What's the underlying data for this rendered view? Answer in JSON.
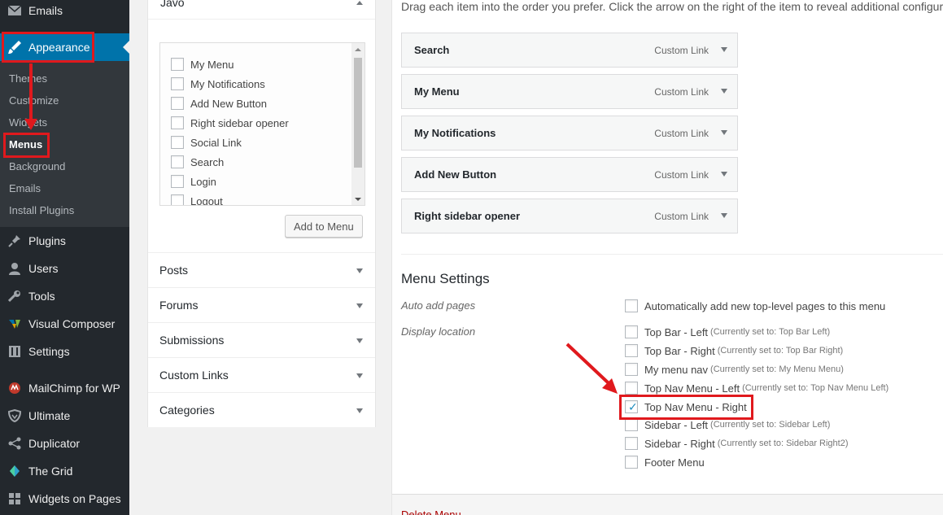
{
  "sidebar": {
    "top_items": [
      {
        "label": "Emails",
        "icon": "envelope-icon"
      },
      {
        "label": "Appearance",
        "icon": "paintbrush-icon"
      }
    ],
    "submenu": [
      "Themes",
      "Customize",
      "Widgets",
      "Menus",
      "Background",
      "Emails",
      "Install Plugins"
    ],
    "bottom_items": [
      {
        "label": "Plugins",
        "icon": "plug-icon"
      },
      {
        "label": "Users",
        "icon": "user-icon"
      },
      {
        "label": "Tools",
        "icon": "wrench-icon"
      },
      {
        "label": "Visual Composer",
        "icon": "visual-composer-icon"
      },
      {
        "label": "Settings",
        "icon": "settings-icon"
      },
      {
        "label": "MailChimp for WP",
        "icon": "mailchimp-icon"
      },
      {
        "label": "Ultimate",
        "icon": "shield-icon"
      },
      {
        "label": "Duplicator",
        "icon": "share-icon"
      },
      {
        "label": "The Grid",
        "icon": "grid-icon"
      },
      {
        "label": "Widgets on Pages",
        "icon": "widgets-icon"
      }
    ]
  },
  "left_panel": {
    "header": "Javo",
    "checklist": [
      "My Menu",
      "My Notifications",
      "Add New Button",
      "Right sidebar opener",
      "Social Link",
      "Search",
      "Login",
      "Logout"
    ],
    "add_button": "Add to Menu",
    "sections": [
      "Posts",
      "Forums",
      "Submissions",
      "Custom Links",
      "Categories"
    ]
  },
  "right_panel": {
    "instructions": "Drag each item into the order you prefer. Click the arrow on the right of the item to reveal additional configuration options.",
    "menu_items": [
      {
        "title": "Search",
        "type": "Custom Link"
      },
      {
        "title": "My Menu",
        "type": "Custom Link"
      },
      {
        "title": "My Notifications",
        "type": "Custom Link"
      },
      {
        "title": "Add New Button",
        "type": "Custom Link"
      },
      {
        "title": "Right sidebar opener",
        "type": "Custom Link"
      }
    ],
    "settings_title": "Menu Settings",
    "auto_add_label": "Auto add pages",
    "auto_add_option": "Automatically add new top-level pages to this menu",
    "display_location_label": "Display location",
    "locations": [
      {
        "label": "Top Bar - Left",
        "note": "(Currently set to: Top Bar Left)",
        "checked": false
      },
      {
        "label": "Top Bar - Right",
        "note": "(Currently set to: Top Bar Right)",
        "checked": false
      },
      {
        "label": "My menu nav",
        "note": "(Currently set to: My Menu Menu)",
        "checked": false
      },
      {
        "label": "Top Nav Menu - Left",
        "note": "(Currently set to: Top Nav Menu Left)",
        "checked": false
      },
      {
        "label": "Top Nav Menu - Right",
        "note": "",
        "checked": true
      },
      {
        "label": "Sidebar - Left",
        "note": "(Currently set to: Sidebar Left)",
        "checked": false
      },
      {
        "label": "Sidebar - Right",
        "note": "(Currently set to: Sidebar Right2)",
        "checked": false
      },
      {
        "label": "Footer Menu",
        "note": "",
        "checked": false
      }
    ],
    "delete_link": "Delete Menu"
  },
  "colors": {
    "highlight": "#e0191d",
    "admin_blue": "#0073aa",
    "sidebar_bg": "#23282d"
  }
}
